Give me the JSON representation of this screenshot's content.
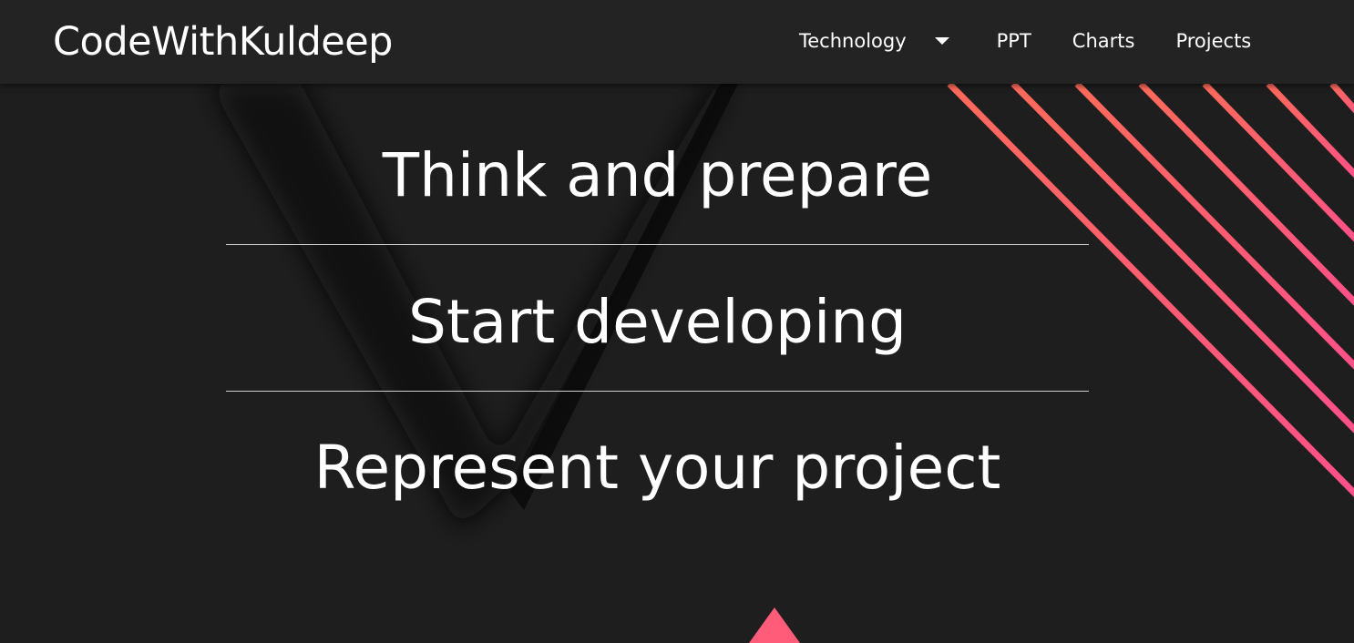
{
  "navbar": {
    "brand": "CodeWithKuldeep",
    "items": [
      {
        "label": "Technology",
        "has_dropdown": true,
        "icon": "chevron-down-icon"
      },
      {
        "label": "PPT"
      },
      {
        "label": "Charts"
      },
      {
        "label": "Projects"
      }
    ]
  },
  "hero": {
    "lines": [
      "Think and prepare",
      "Start developing",
      "Represent your project"
    ]
  },
  "colors": {
    "background": "#1e1e1e",
    "navbar_bg": "#232323",
    "accent_start": "#ff6a5a",
    "accent_end": "#ff4f8b",
    "text": "#ffffff"
  }
}
